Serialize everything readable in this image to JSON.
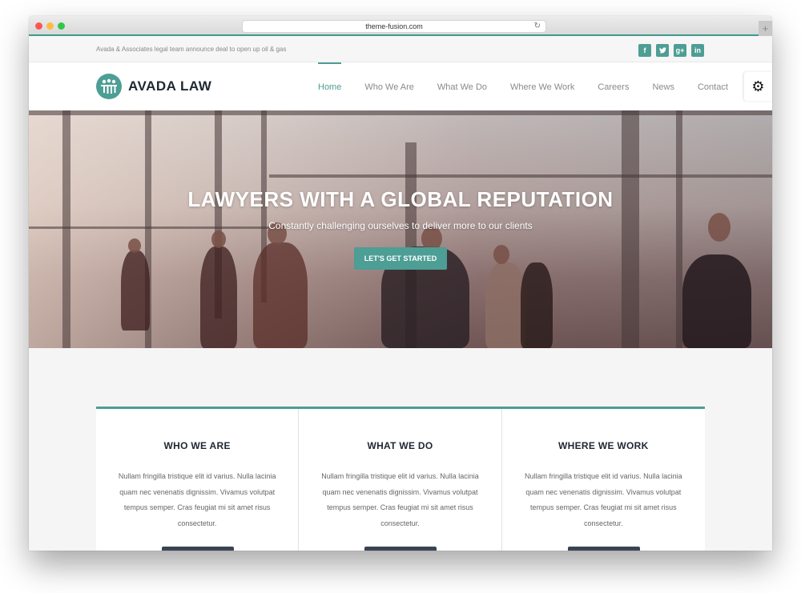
{
  "browser": {
    "url": "theme-fusion.com",
    "reload_icon": "↻",
    "new_tab_icon": "+"
  },
  "topbar": {
    "announcement": "Avada & Associates legal team announce deal to open up oil & gas",
    "social": [
      {
        "name": "facebook",
        "glyph": "f"
      },
      {
        "name": "twitter",
        "glyph": "t"
      },
      {
        "name": "google-plus",
        "glyph": "g+"
      },
      {
        "name": "linkedin",
        "glyph": "in"
      }
    ]
  },
  "header": {
    "brand": "AVADA LAW",
    "nav": [
      {
        "label": "Home",
        "active": true
      },
      {
        "label": "Who We Are"
      },
      {
        "label": "What We Do"
      },
      {
        "label": "Where We Work"
      },
      {
        "label": "Careers"
      },
      {
        "label": "News"
      },
      {
        "label": "Contact"
      }
    ],
    "gear_icon": "⚙"
  },
  "hero": {
    "title": "LAWYERS WITH A GLOBAL REPUTATION",
    "subtitle": "Constantly challenging ourselves to deliver more to our clients",
    "cta_label": "LET'S GET STARTED"
  },
  "colors": {
    "accent": "#4d9e94",
    "dark": "#1f2732"
  },
  "features": [
    {
      "title": "WHO WE ARE",
      "text": "Nullam fringilla tristique elit id varius. Nulla lacinia quam nec venenatis dignissim. Vivamus volutpat tempus semper. Cras feugiat mi sit amet risus consectetur."
    },
    {
      "title": "WHAT WE DO",
      "text": "Nullam fringilla tristique elit id varius. Nulla lacinia quam nec venenatis dignissim. Vivamus volutpat tempus semper. Cras feugiat mi sit amet risus consectetur."
    },
    {
      "title": "WHERE WE WORK",
      "text": "Nullam fringilla tristique elit id varius. Nulla lacinia quam nec venenatis dignissim. Vivamus volutpat tempus semper. Cras feugiat mi sit amet risus consectetur."
    }
  ]
}
